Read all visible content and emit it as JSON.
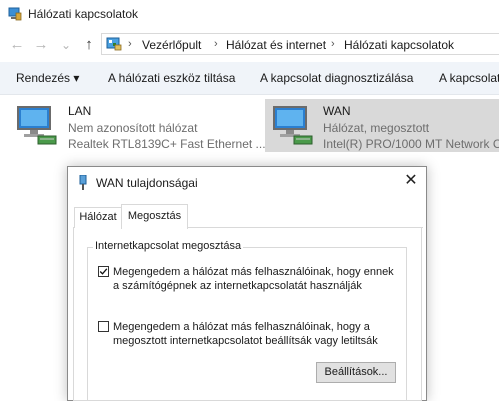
{
  "window": {
    "title": "Hálózati kapcsolatok"
  },
  "address": {
    "crumbs": [
      "Vezérlőpult",
      "Hálózat és internet",
      "Hálózati kapcsolatok"
    ],
    "separator": "›"
  },
  "nav": {
    "back": "←",
    "forward": "→",
    "dropdown": "⌄",
    "up": "↑"
  },
  "commands": [
    {
      "label": "Rendezés ▾"
    },
    {
      "label": "A hálózati eszköz tiltása"
    },
    {
      "label": "A kapcsolat diagnosztizálása"
    },
    {
      "label": "A kapcsolat"
    }
  ],
  "adapters": [
    {
      "name": "LAN",
      "status": "Nem azonosított hálózat",
      "device": "Realtek RTL8139C+ Fast Ethernet ..."
    },
    {
      "name": "WAN",
      "status": "Hálózat, megosztott",
      "device": "Intel(R) PRO/1000 MT Network C..."
    }
  ],
  "dialog": {
    "title": "WAN tulajdonságai",
    "close": "✕",
    "tabs": [
      "Hálózat",
      "Megosztás"
    ],
    "active_tab": "Megosztás",
    "group_label": "Internetkapcsolat megosztása",
    "option1": {
      "line1": "Megengedem a hálózat más felhasználóinak, hogy ennek",
      "line2": "a számítógépnek az internetkapcsolatát használják",
      "checked": true
    },
    "option2": {
      "line1": "Megengedem a hálózat más felhasználóinak, hogy a",
      "line2": "megosztott internetkapcsolatot beállítsák vagy letiltsák",
      "checked": false
    },
    "settings_button": "Beállítások..."
  },
  "colors": {
    "accent": "#0078d7",
    "selection": "#d9d9d9",
    "commandbar": "#f0f4f9"
  },
  "icons": [
    "network-connections-icon",
    "back-arrow-icon",
    "forward-arrow-icon",
    "dropdown-icon",
    "up-arrow-icon",
    "control-panel-icon",
    "network-adapter-icon",
    "close-icon",
    "checkbox-checked-icon"
  ]
}
